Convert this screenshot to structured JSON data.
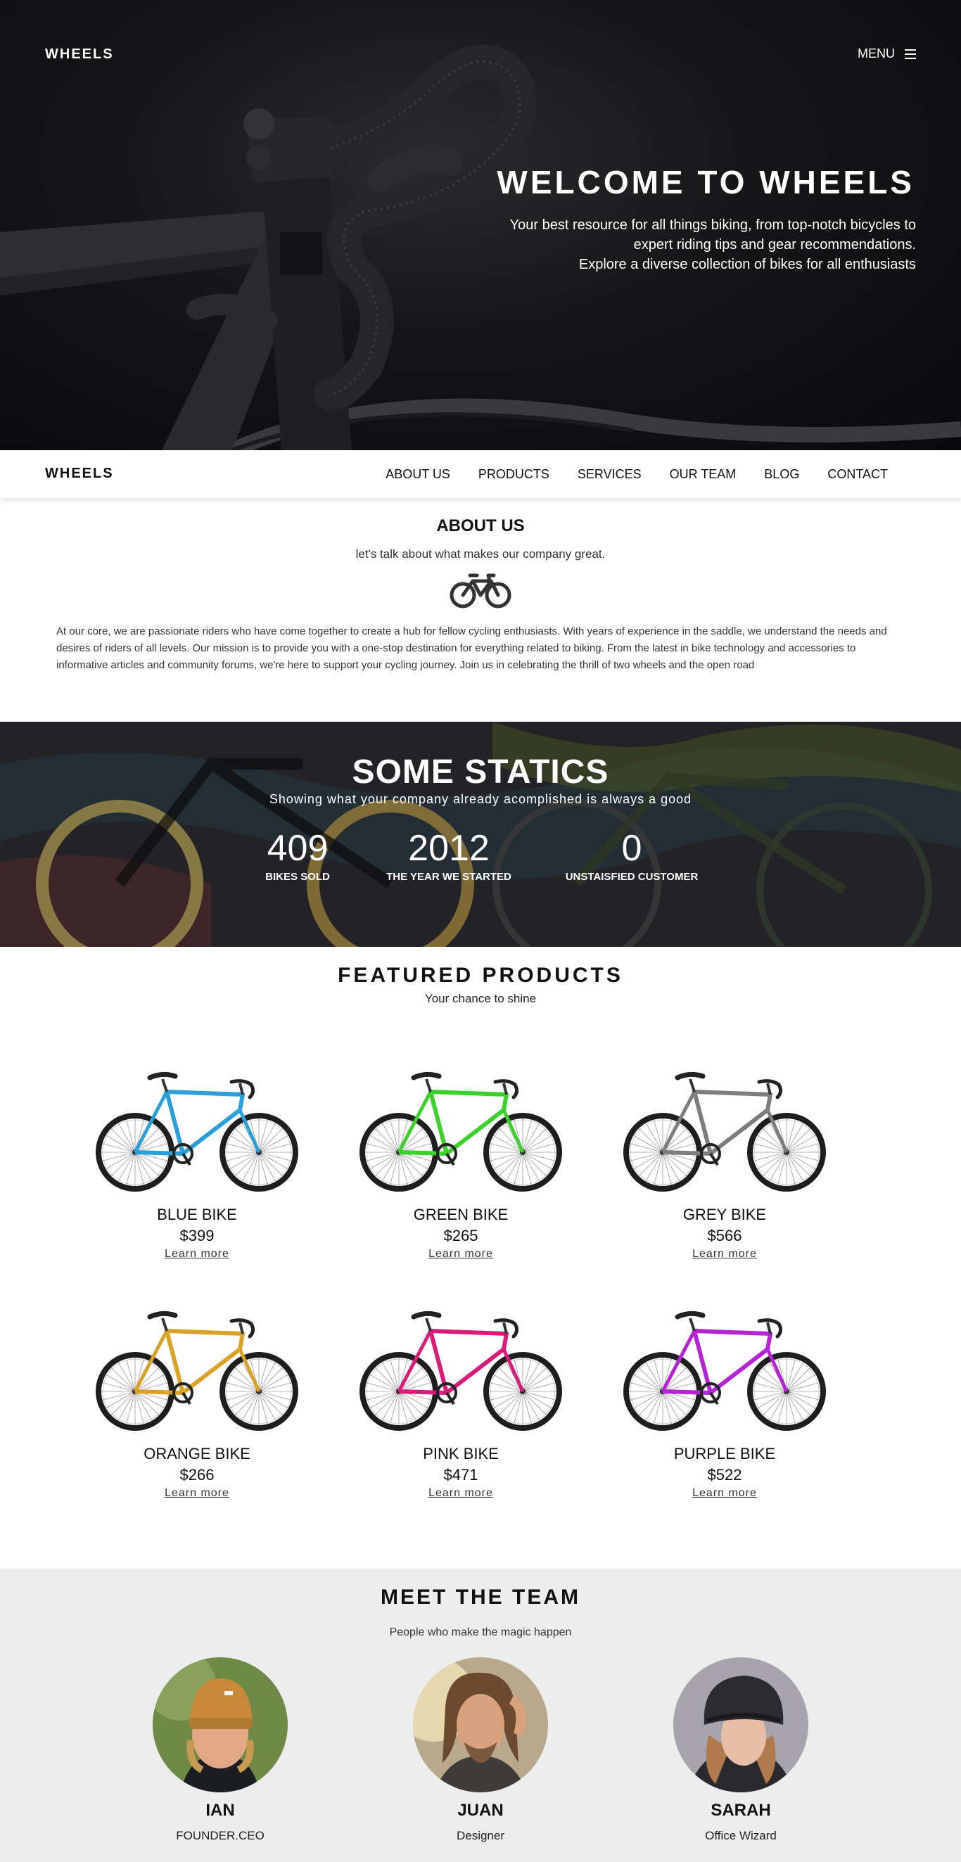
{
  "hero": {
    "logo": "WHEELS",
    "menu_label": "MENU",
    "title": "WELCOME TO WHEELS",
    "subtitle_line1": "Your best resource for all things biking, from top-notch bicycles to",
    "subtitle_line2": "expert riding tips and gear recommendations.",
    "subtitle_line3": "Explore a diverse collection of bikes for all enthusiasts"
  },
  "navbar": {
    "logo": "WHEELS",
    "links": [
      "ABOUT US",
      "PRODUCTS",
      "SERVICES",
      "OUR TEAM",
      "BLOG",
      "CONTACT"
    ]
  },
  "about": {
    "heading": "ABOUT US",
    "tagline": "let's talk about what makes our company great.",
    "icon": "bicycle-icon",
    "body": "At our core, we are passionate riders who have come together to create a hub for fellow cycling enthusiasts. With years of experience in the saddle, we understand the needs and desires of riders of all levels. Our mission is to provide you with a one-stop destination for everything related to biking. From the latest in bike technology and accessories to informative articles and community forums, we're here to support your cycling journey. Join us in celebrating the thrill of two wheels and the open road"
  },
  "stats": {
    "heading": "SOME STATICS",
    "tagline": "Showing what your company already acomplished is always a good",
    "items": [
      {
        "value": "409",
        "label": "BIKES SOLD"
      },
      {
        "value": "2012",
        "label": "THE YEAR WE STARTED"
      },
      {
        "value": "0",
        "label": "UNSTAISFIED CUSTOMER"
      }
    ]
  },
  "products": {
    "heading": "FEATURED PRODUCTS",
    "tagline": "Your chance to shine",
    "items": [
      {
        "name": "BLUE BIKE",
        "price": "$399",
        "link": "Learn more",
        "color": "#2a9fd8"
      },
      {
        "name": "GREEN BIKE",
        "price": "$265",
        "link": "Learn more",
        "color": "#3cd12a"
      },
      {
        "name": "GREY BIKE",
        "price": "$566",
        "link": "Learn more",
        "color": "#7d7d7d"
      },
      {
        "name": "ORANGE BIKE",
        "price": "$266",
        "link": "Learn more",
        "color": "#d9a227"
      },
      {
        "name": "PINK BIKE",
        "price": "$471",
        "link": "Learn more",
        "color": "#d81c7a"
      },
      {
        "name": "PURPLE BIKE",
        "price": "$522",
        "link": "Learn more",
        "color": "#b524d4"
      }
    ]
  },
  "team": {
    "heading": "MEET THE TEAM",
    "tagline": "People who make the magic happen",
    "members": [
      {
        "name": "IAN",
        "role": "FOUNDER.CEO"
      },
      {
        "name": "JUAN",
        "role": "Designer"
      },
      {
        "name": "SARAH",
        "role": "Office Wizard"
      }
    ]
  }
}
